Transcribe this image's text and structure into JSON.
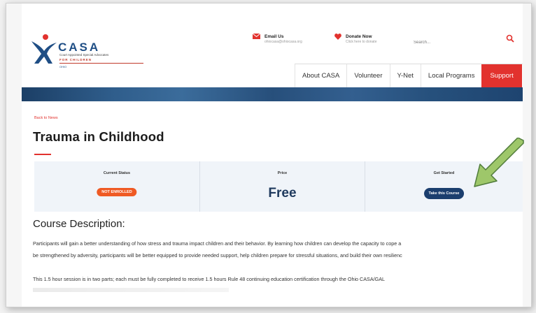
{
  "logo": {
    "wordmark": "CASA",
    "tagline": "Court Appointed Special Advocates",
    "sub": "FOR CHILDREN",
    "state": "OHIO"
  },
  "header": {
    "email": {
      "label": "Email Us",
      "value": "ohiocasa@ohiocasa.org",
      "icon": "envelope-icon"
    },
    "donate": {
      "label": "Donate Now",
      "value": "Click here to donate",
      "icon": "heart-icon"
    },
    "search": {
      "placeholder": "Search...",
      "icon": "search-icon"
    }
  },
  "nav": {
    "items": [
      {
        "label": "About CASA"
      },
      {
        "label": "Volunteer"
      },
      {
        "label": "Y-Net"
      },
      {
        "label": "Local Programs"
      },
      {
        "label": "Support"
      }
    ]
  },
  "course": {
    "back_link": "Back to News",
    "title": "Trauma in Childhood"
  },
  "status": {
    "current_status_label": "Current Status",
    "current_status_value": "NOT ENROLLED",
    "price_label": "Price",
    "price_value": "Free",
    "get_started_label": "Get Started",
    "cta_label": "Take this Course"
  },
  "description": {
    "heading": "Course Description:",
    "para1_line1": "Participants will gain a better understanding of how stress and trauma impact children and their behavior.  By learning how children can develop the capacity to cope a",
    "para1_line2": "be strengthened by adversity,  participants will be better equipped to provide needed support, help children prepare for stressful situations, and build their own resilienc",
    "para2_line1": "This 1.5 hour session is in two parts; each must be fully completed to receive 1.5 hours Rule 48 continuing education certification through the Ohio CASA/GAL"
  },
  "colors": {
    "brand_blue": "#1f4e85",
    "accent_red": "#e2322e",
    "badge_orange": "#ef5a24",
    "cta_navy": "#1b3e6e",
    "arrow_green": "#9ec76a"
  }
}
